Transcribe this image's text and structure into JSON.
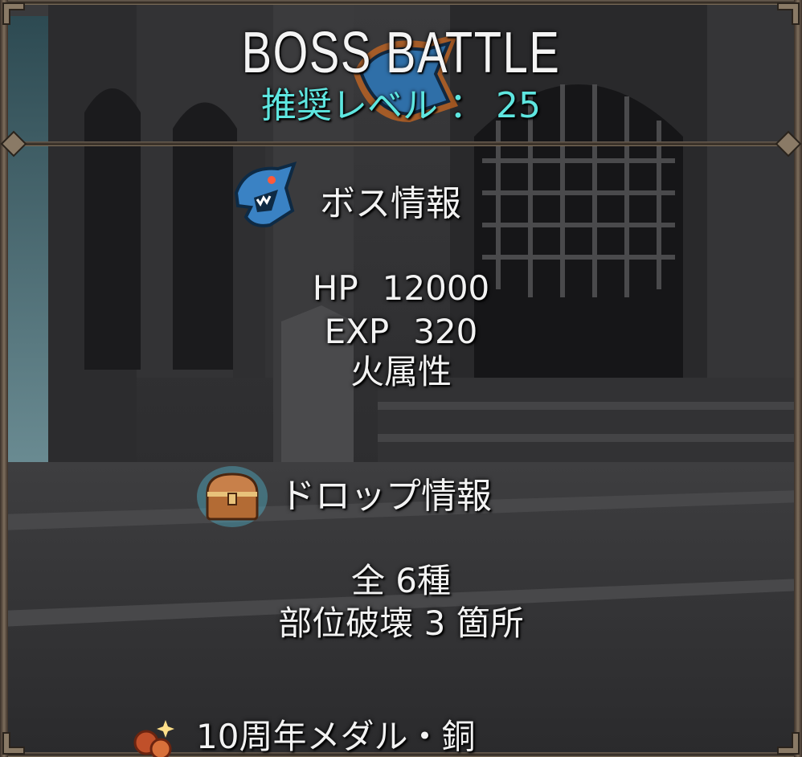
{
  "header": {
    "title": "BOSS BATTLE",
    "recommended_level": "推奨レベル ： 25"
  },
  "boss_info": {
    "heading": "ボス情報",
    "icon": "boss-shark-icon",
    "hp_label": "HP",
    "hp_value": "12000",
    "exp_label": "EXP",
    "exp_value": "320",
    "attribute": "火属性"
  },
  "drop_info": {
    "heading": "ドロップ情報",
    "icon": "treasure-chest-icon",
    "total": "全 6種",
    "part_break": "部位破壊 3 箇所",
    "first_item": "10周年メダル・銅",
    "first_item_icon": "medal-icon"
  },
  "colors": {
    "title": "#f4f4f4",
    "recommended_level": "#5ee6e0",
    "frame": "#7d6d5c"
  }
}
